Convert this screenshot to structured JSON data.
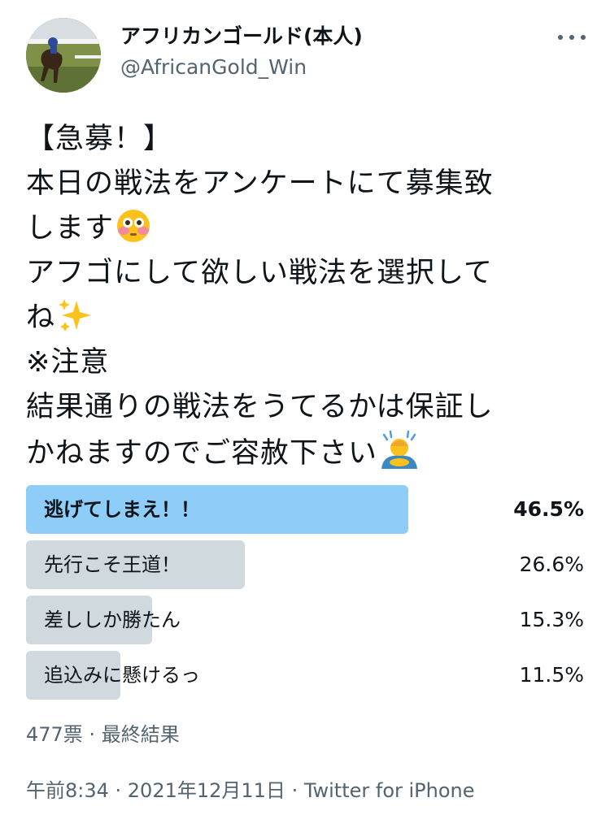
{
  "author": {
    "display_name": "アフリカンゴールド(本人)",
    "handle": "@AfricanGold_Win"
  },
  "tweet": {
    "lines": [
      "【急募！】",
      "本日の戦法をアンケートにて募集致",
      "します",
      "アフゴにして欲しい戦法を選択して",
      "ね",
      "※注意",
      "結果通りの戦法をうてるかは保証し",
      "かねますのでご容赦下さい"
    ],
    "emojis": [
      "flushed-face-emoji",
      "sparkles-emoji",
      "person-bowing-emoji"
    ]
  },
  "poll": {
    "options": [
      {
        "label": "逃げてしまえ！！",
        "percent_text": "46.5%",
        "percent": 46.5
      },
      {
        "label": "先行こそ王道！",
        "percent_text": "26.6%",
        "percent": 26.6
      },
      {
        "label": "差ししか勝たん",
        "percent_text": "15.3%",
        "percent": 15.3
      },
      {
        "label": "追込みに懸けるっ",
        "percent_text": "11.5%",
        "percent": 11.5
      }
    ],
    "meta": "477票 · 最終結果"
  },
  "timestamp": "午前8:34 · 2021年12月11日 · Twitter for iPhone",
  "colors": {
    "winner_bar": "#8ecdf8",
    "bar": "#cfd9de",
    "secondary_text": "#536471"
  }
}
